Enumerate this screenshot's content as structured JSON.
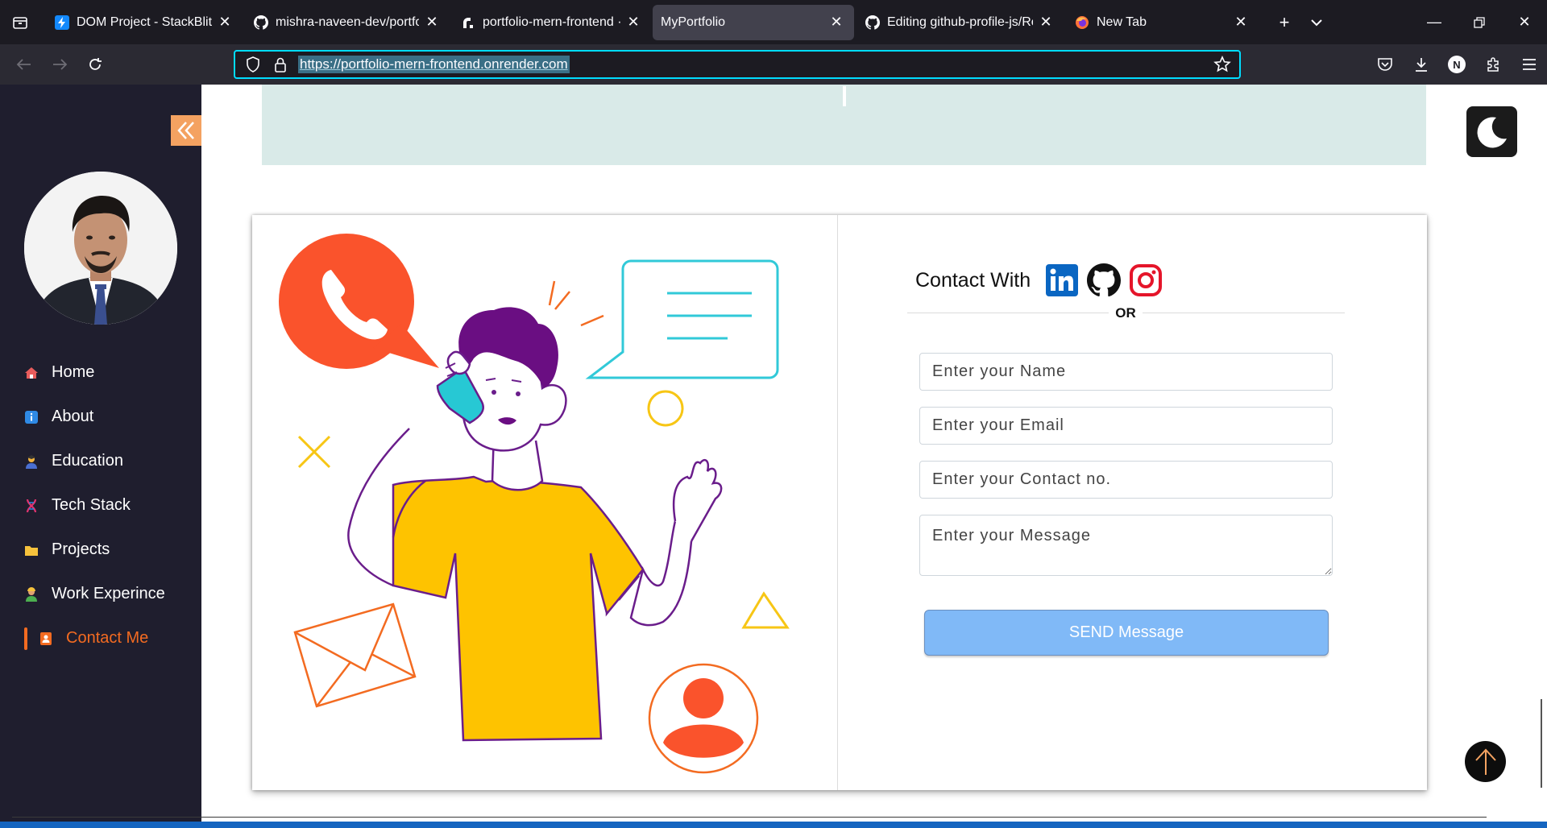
{
  "browser": {
    "tabs": [
      {
        "title": "DOM Project - StackBlitz",
        "icon": "stackblitz-icon",
        "active": false
      },
      {
        "title": "mishra-naveen-dev/portfolio",
        "icon": "github-icon",
        "active": false
      },
      {
        "title": "portfolio-mern-frontend ·",
        "icon": "render-icon",
        "active": false
      },
      {
        "title": "MyPortfolio",
        "icon": "",
        "active": true
      },
      {
        "title": "Editing github-profile-js/Re",
        "icon": "github-icon",
        "active": false
      },
      {
        "title": "New Tab",
        "icon": "firefox-icon",
        "active": false
      }
    ],
    "url": "https://portfolio-mern-frontend.onrender.com",
    "profile_initial": "N"
  },
  "sidebar": {
    "items": [
      {
        "label": "Home",
        "icon": "home-icon",
        "color": "#e85c5c"
      },
      {
        "label": "About",
        "icon": "info-icon",
        "color": "#2f8ae5"
      },
      {
        "label": "Education",
        "icon": "student-icon",
        "color": "#f2b33d"
      },
      {
        "label": "Tech Stack",
        "icon": "dna-icon",
        "color": "#e0336f"
      },
      {
        "label": "Projects",
        "icon": "folder-icon",
        "color": "#f6c23c"
      },
      {
        "label": "Work Experince",
        "icon": "worker-icon",
        "color": "#4caf50"
      },
      {
        "label": "Contact Me",
        "icon": "contact-card-icon",
        "color": "#f36b21",
        "active": true
      }
    ]
  },
  "contact": {
    "heading": "Contact With",
    "or_label": "OR",
    "name_placeholder": "Enter your Name",
    "email_placeholder": "Enter your Email",
    "phone_placeholder": "Enter your Contact no.",
    "message_placeholder": "Enter your Message",
    "send_label": "SEND Message"
  },
  "colors": {
    "accent": "#f36b21",
    "sidebar_bg": "#1f1e2e",
    "button": "#80b9f7",
    "band": "#d9eae8"
  }
}
